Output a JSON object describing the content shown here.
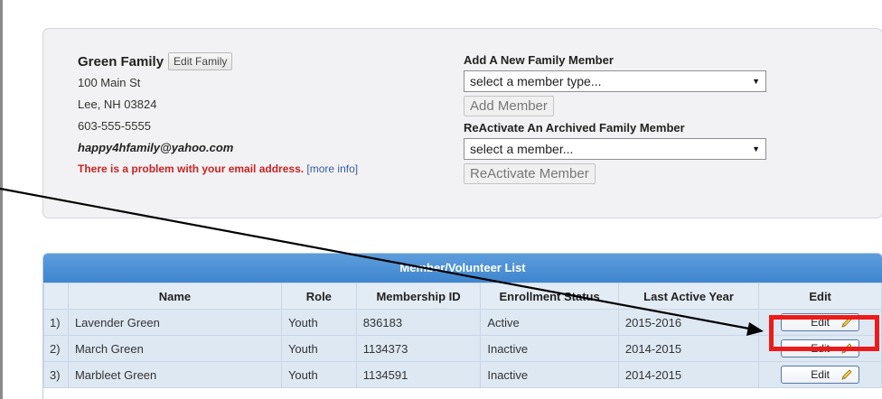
{
  "family": {
    "name": "Green Family",
    "edit_label": "Edit Family",
    "address_line1": "100 Main St",
    "address_line2": "Lee, NH 03824",
    "phone": "603-555-5555",
    "email": "happy4hfamily@yahoo.com",
    "email_warning": "There is a problem with your email address.",
    "more_info": "[more info]"
  },
  "add_member": {
    "title": "Add A New Family Member",
    "select_value": "select a member type...",
    "button_label": "Add Member"
  },
  "reactivate": {
    "title": "ReActivate An Archived Family Member",
    "select_value": "select a member...",
    "button_label": "ReActivate Member"
  },
  "member_list": {
    "title": "Member/Volunteer List",
    "columns": [
      "Name",
      "Role",
      "Membership ID",
      "Enrollment Status",
      "Last Active Year",
      "Edit"
    ],
    "rows": [
      {
        "num": "1)",
        "name": "Lavender Green",
        "role": "Youth",
        "membership_id": "836183",
        "status": "Active",
        "last_year": "2015-2016",
        "edit": "Edit"
      },
      {
        "num": "2)",
        "name": "March Green",
        "role": "Youth",
        "membership_id": "1134373",
        "status": "Inactive",
        "last_year": "2014-2015",
        "edit": "Edit"
      },
      {
        "num": "3)",
        "name": "Marbleet Green",
        "role": "Youth",
        "membership_id": "1134591",
        "status": "Inactive",
        "last_year": "2014-2015",
        "edit": "Edit"
      }
    ]
  },
  "colors": {
    "header_blue": "#4a90d9",
    "highlight_red": "#ee1a1a",
    "warning_red": "#cc2222",
    "link_blue": "#355d9e"
  }
}
